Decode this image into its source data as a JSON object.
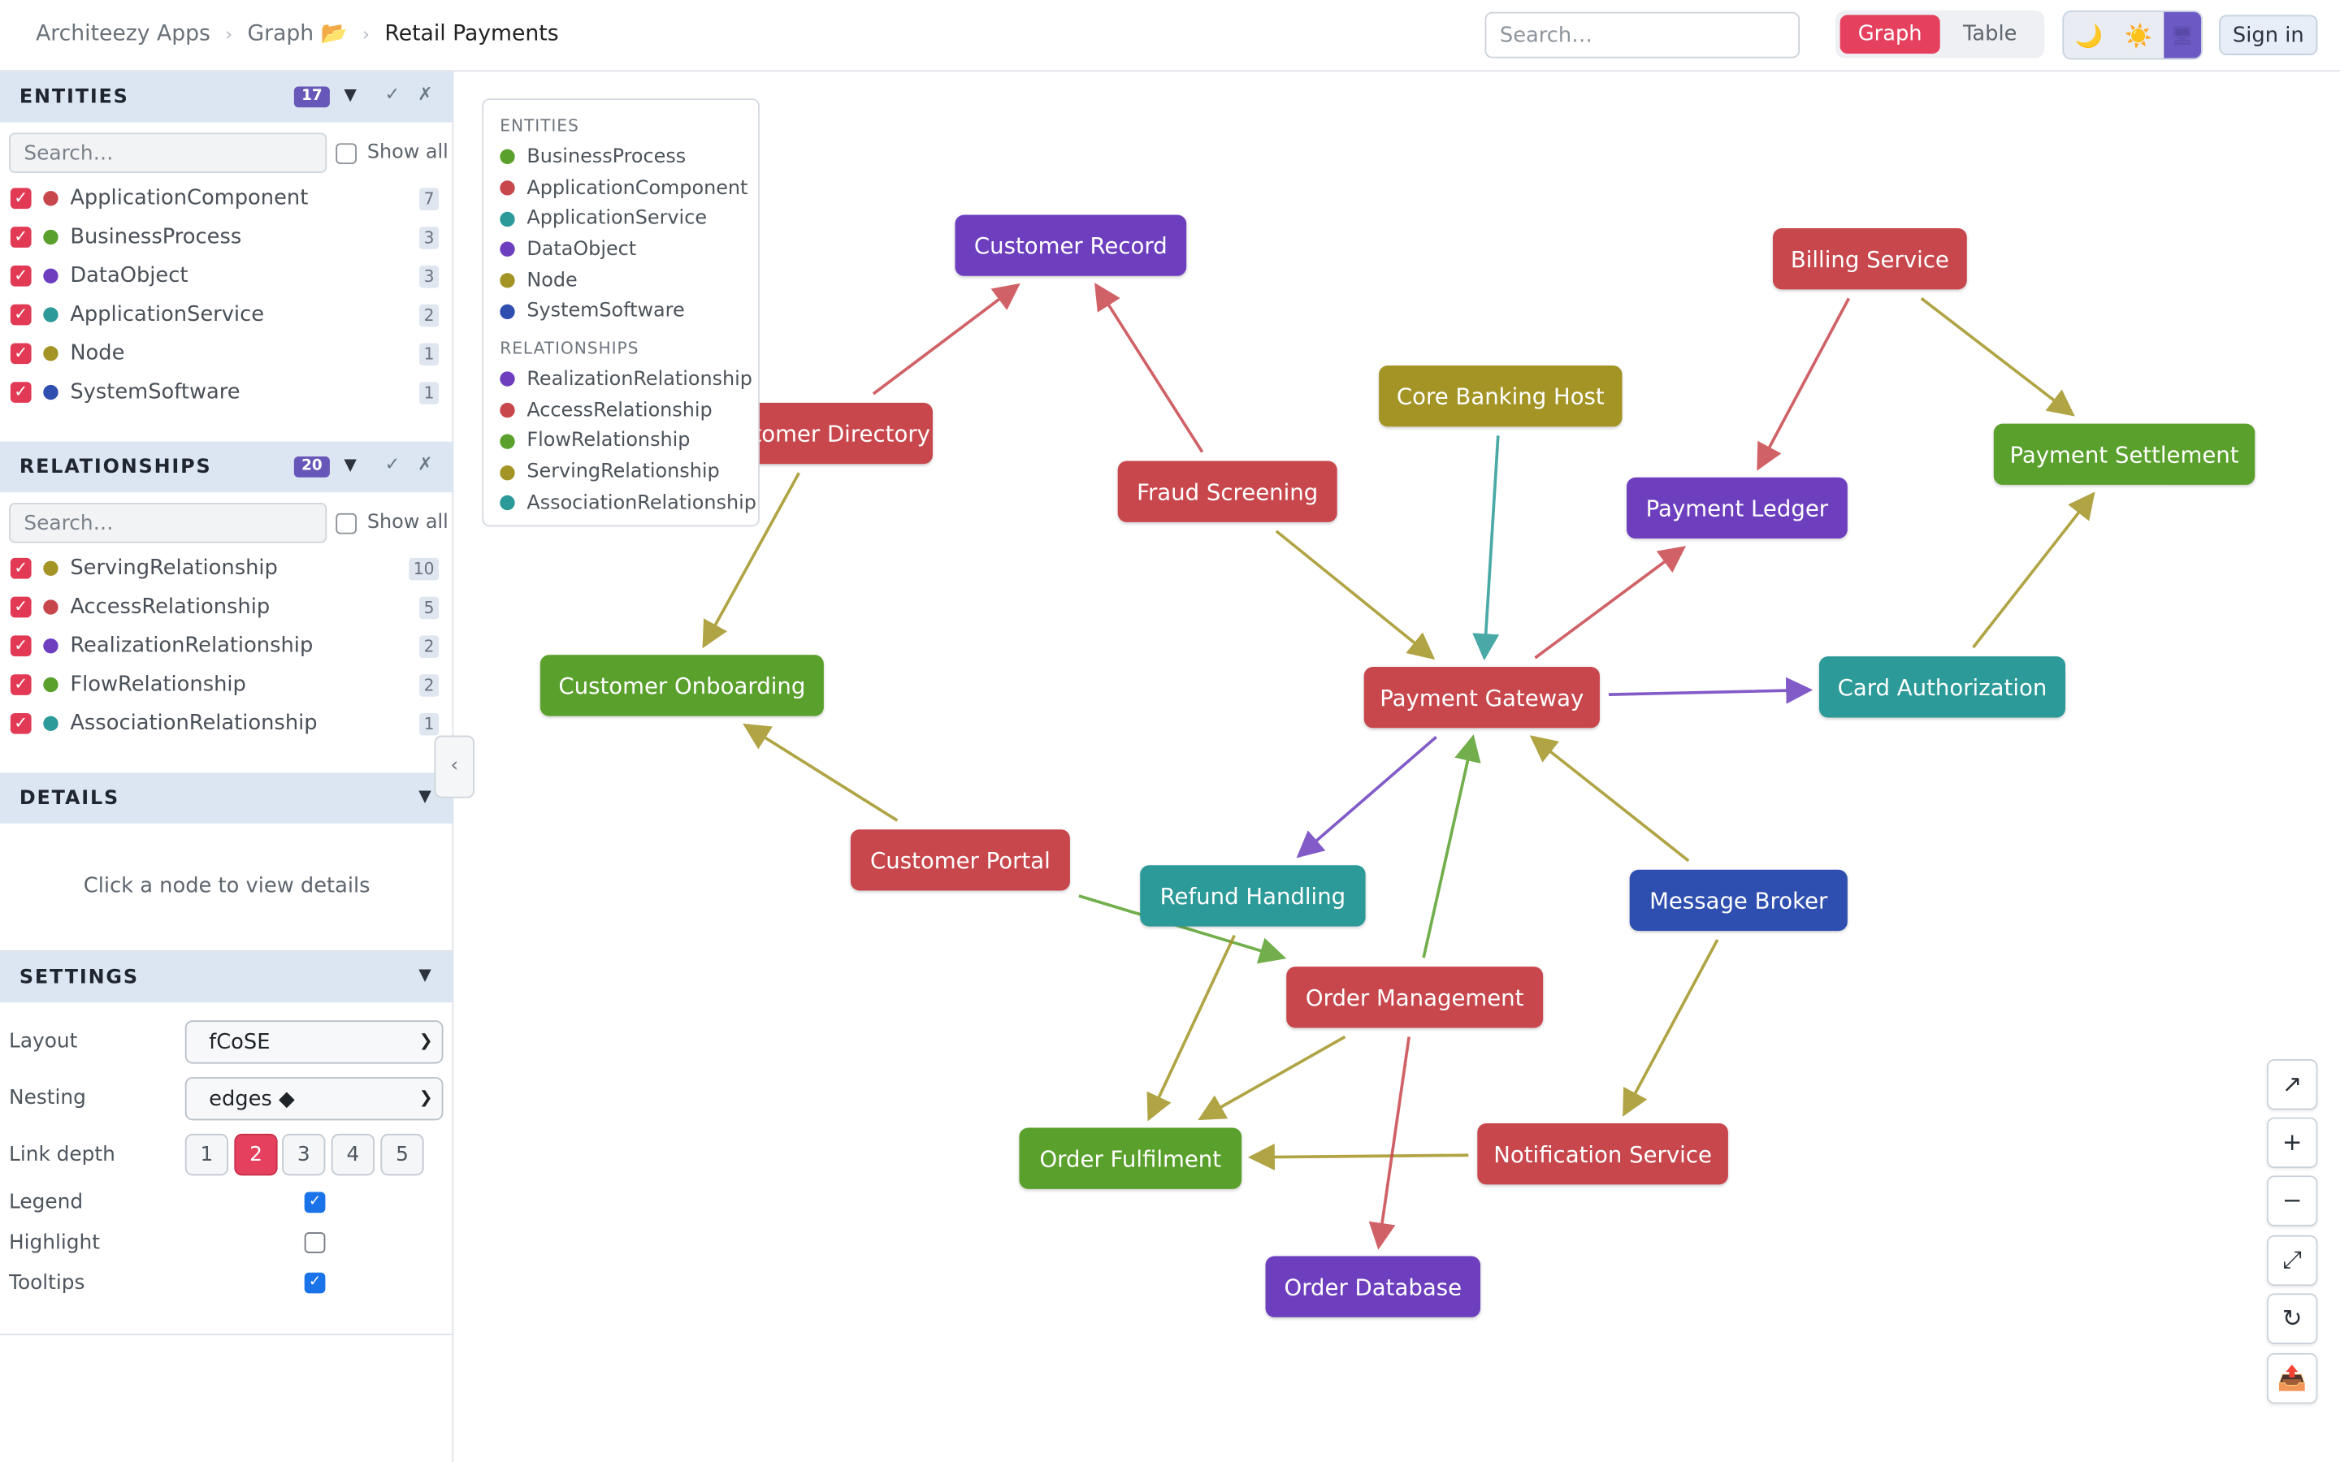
{
  "breadcrumb": {
    "app": "Architeezy Apps",
    "section": "Graph 📂",
    "current": "Retail Payments"
  },
  "header": {
    "search_placeholder": "Search…",
    "view_graph": "Graph",
    "view_table": "Table",
    "theme_dark_icon": "🌙",
    "theme_light_icon": "☀️",
    "theme_system_icon": "🖥",
    "sign_in": "Sign in",
    "active_view": "Graph"
  },
  "sidebar": {
    "entities": {
      "title": "ENTITIES",
      "count": "17",
      "search_placeholder": "Search…",
      "show_all": "Show all",
      "items": [
        {
          "label": "ApplicationComponent",
          "count": "7",
          "color": "#c8474d"
        },
        {
          "label": "BusinessProcess",
          "count": "3",
          "color": "#5aa02c"
        },
        {
          "label": "DataObject",
          "count": "3",
          "color": "#6d3fbf"
        },
        {
          "label": "ApplicationService",
          "count": "2",
          "color": "#2b9a98"
        },
        {
          "label": "Node",
          "count": "1",
          "color": "#a39425"
        },
        {
          "label": "SystemSoftware",
          "count": "1",
          "color": "#2f4fb0"
        }
      ]
    },
    "relationships": {
      "title": "RELATIONSHIPS",
      "count": "20",
      "search_placeholder": "Search…",
      "show_all": "Show all",
      "items": [
        {
          "label": "ServingRelationship",
          "count": "10",
          "color": "#a39425"
        },
        {
          "label": "AccessRelationship",
          "count": "5",
          "color": "#c8474d"
        },
        {
          "label": "RealizationRelationship",
          "count": "2",
          "color": "#6d3fbf"
        },
        {
          "label": "FlowRelationship",
          "count": "2",
          "color": "#5aa02c"
        },
        {
          "label": "AssociationRelationship",
          "count": "1",
          "color": "#2b9a98"
        }
      ]
    },
    "details": {
      "title": "DETAILS",
      "empty_text": "Click a node to view details"
    },
    "settings": {
      "title": "SETTINGS",
      "layout_label": "Layout",
      "layout_value": "fCoSE",
      "nesting_label": "Nesting",
      "nesting_value": "edges ◆",
      "link_depth_label": "Link depth",
      "link_depth_options": [
        "1",
        "2",
        "3",
        "4",
        "5"
      ],
      "link_depth_selected": "2",
      "legend_label": "Legend",
      "legend_checked": true,
      "highlight_label": "Highlight",
      "highlight_checked": false,
      "tooltips_label": "Tooltips",
      "tooltips_checked": true
    }
  },
  "legend": {
    "entities_title": "ENTITIES",
    "entities": [
      {
        "label": "BusinessProcess",
        "color": "#5aa02c"
      },
      {
        "label": "ApplicationComponent",
        "color": "#c8474d"
      },
      {
        "label": "ApplicationService",
        "color": "#2b9a98"
      },
      {
        "label": "DataObject",
        "color": "#6d3fbf"
      },
      {
        "label": "Node",
        "color": "#a39425"
      },
      {
        "label": "SystemSoftware",
        "color": "#2f4fb0"
      }
    ],
    "relationships_title": "RELATIONSHIPS",
    "relationships": [
      {
        "label": "RealizationRelationship",
        "color": "#6d3fbf"
      },
      {
        "label": "AccessRelationship",
        "color": "#c8474d"
      },
      {
        "label": "FlowRelationship",
        "color": "#5aa02c"
      },
      {
        "label": "ServingRelationship",
        "color": "#a39425"
      },
      {
        "label": "AssociationRelationship",
        "color": "#2b9a98"
      }
    ]
  },
  "graph": {
    "nodes": [
      {
        "id": "customer-record",
        "label": "Customer Record",
        "type": "DataObject"
      },
      {
        "id": "customer-directory",
        "label": "Customer Directory",
        "type": "ApplicationComponent"
      },
      {
        "id": "billing-service",
        "label": "Billing Service",
        "type": "ApplicationComponent"
      },
      {
        "id": "core-banking-host",
        "label": "Core Banking Host",
        "type": "Node"
      },
      {
        "id": "payment-settlement",
        "label": "Payment Settlement",
        "type": "BusinessProcess"
      },
      {
        "id": "fraud-screening",
        "label": "Fraud Screening",
        "type": "ApplicationComponent"
      },
      {
        "id": "payment-ledger",
        "label": "Payment Ledger",
        "type": "DataObject"
      },
      {
        "id": "customer-onboarding",
        "label": "Customer Onboarding",
        "type": "BusinessProcess"
      },
      {
        "id": "payment-gateway",
        "label": "Payment Gateway",
        "type": "ApplicationComponent"
      },
      {
        "id": "card-authorization",
        "label": "Card Authorization",
        "type": "ApplicationService"
      },
      {
        "id": "customer-portal",
        "label": "Customer Portal",
        "type": "ApplicationComponent"
      },
      {
        "id": "refund-handling",
        "label": "Refund Handling",
        "type": "ApplicationService"
      },
      {
        "id": "message-broker",
        "label": "Message Broker",
        "type": "SystemSoftware"
      },
      {
        "id": "order-management",
        "label": "Order Management",
        "type": "ApplicationComponent"
      },
      {
        "id": "order-fulfilment",
        "label": "Order Fulfilment",
        "type": "BusinessProcess"
      },
      {
        "id": "notification-service",
        "label": "Notification Service",
        "type": "ApplicationComponent"
      },
      {
        "id": "order-database",
        "label": "Order Database",
        "type": "DataObject"
      }
    ],
    "edges": [
      {
        "from": "customer-directory",
        "to": "customer-record",
        "type": "AccessRelationship"
      },
      {
        "from": "fraud-screening",
        "to": "customer-record",
        "type": "AccessRelationship"
      },
      {
        "from": "customer-directory",
        "to": "customer-onboarding",
        "type": "ServingRelationship"
      },
      {
        "from": "fraud-screening",
        "to": "payment-gateway",
        "type": "ServingRelationship"
      },
      {
        "from": "core-banking-host",
        "to": "payment-gateway",
        "type": "AssociationRelationship"
      },
      {
        "from": "billing-service",
        "to": "payment-ledger",
        "type": "AccessRelationship"
      },
      {
        "from": "billing-service",
        "to": "payment-settlement",
        "type": "ServingRelationship"
      },
      {
        "from": "payment-gateway",
        "to": "payment-ledger",
        "type": "AccessRelationship"
      },
      {
        "from": "payment-gateway",
        "to": "card-authorization",
        "type": "RealizationRelationship"
      },
      {
        "from": "card-authorization",
        "to": "payment-settlement",
        "type": "ServingRelationship"
      },
      {
        "from": "customer-portal",
        "to": "customer-onboarding",
        "type": "ServingRelationship"
      },
      {
        "from": "payment-gateway",
        "to": "refund-handling",
        "type": "RealizationRelationship"
      },
      {
        "from": "order-management",
        "to": "payment-gateway",
        "type": "FlowRelationship"
      },
      {
        "from": "message-broker",
        "to": "payment-gateway",
        "type": "ServingRelationship"
      },
      {
        "from": "customer-portal",
        "to": "order-management",
        "type": "FlowRelationship"
      },
      {
        "from": "refund-handling",
        "to": "order-fulfilment",
        "type": "ServingRelationship"
      },
      {
        "from": "order-management",
        "to": "order-fulfilment",
        "type": "ServingRelationship"
      },
      {
        "from": "message-broker",
        "to": "notification-service",
        "type": "ServingRelationship"
      },
      {
        "from": "notification-service",
        "to": "order-fulfilment",
        "type": "ServingRelationship"
      },
      {
        "from": "order-management",
        "to": "order-database",
        "type": "AccessRelationship"
      }
    ]
  },
  "controls": [
    {
      "name": "export-icon",
      "glyph": "↗"
    },
    {
      "name": "zoom-in-icon",
      "glyph": "+"
    },
    {
      "name": "zoom-out-icon",
      "glyph": "−"
    },
    {
      "name": "fit-icon",
      "glyph": "⤢"
    },
    {
      "name": "relayout-icon",
      "glyph": "↻"
    },
    {
      "name": "download-icon",
      "glyph": "📤"
    }
  ]
}
